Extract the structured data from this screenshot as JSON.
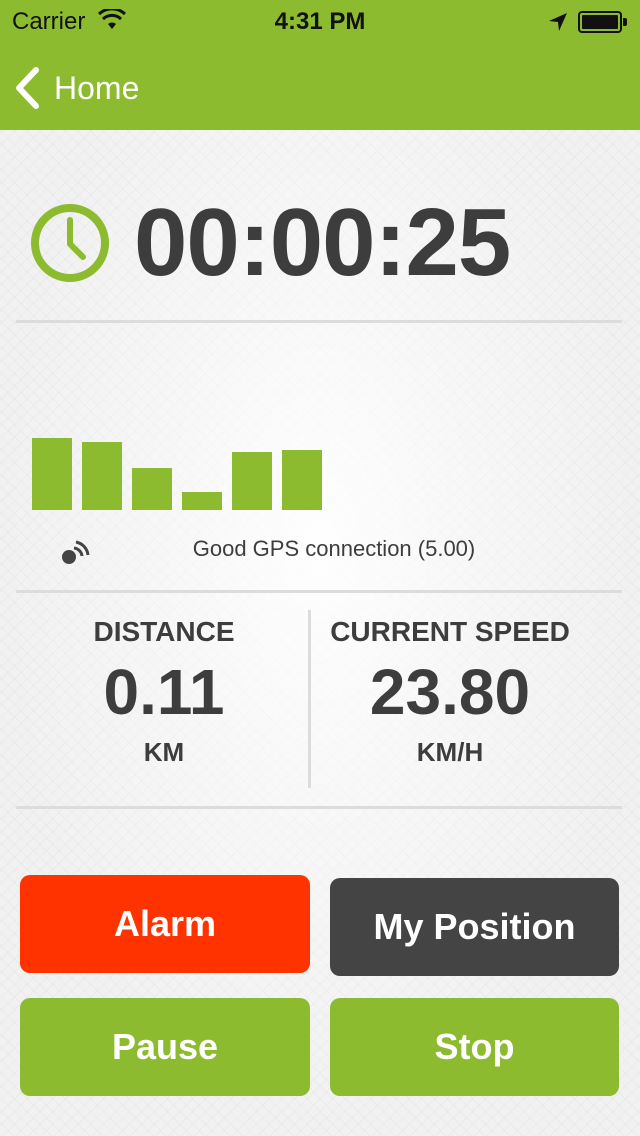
{
  "status_bar": {
    "carrier": "Carrier",
    "time": "4:31 PM",
    "icons": [
      "wifi-icon",
      "location-arrow-icon",
      "battery-icon"
    ]
  },
  "nav": {
    "back_label": "Home",
    "back_icon": "chevron-left-icon"
  },
  "timer": {
    "icon": "clock-icon",
    "elapsed": "00:00:25"
  },
  "gps": {
    "signal_bar_levels": [
      0.72,
      0.68,
      0.42,
      0.18,
      0.58,
      0.6
    ],
    "icon": "gps-signal-icon",
    "status_text": "Good GPS connection (5.00)"
  },
  "stats": {
    "distance": {
      "label": "DISTANCE",
      "value": "0.11",
      "unit": "KM"
    },
    "speed": {
      "label": "CURRENT SPEED",
      "value": "23.80",
      "unit": "KM/H"
    }
  },
  "buttons": {
    "alarm": "Alarm",
    "my_position": "My Position",
    "pause": "Pause",
    "stop": "Stop"
  },
  "colors": {
    "brand_green": "#8cbb2f",
    "alarm_red": "#ff3300",
    "dark_button": "#444444",
    "text_dark": "#3d3d3d"
  }
}
